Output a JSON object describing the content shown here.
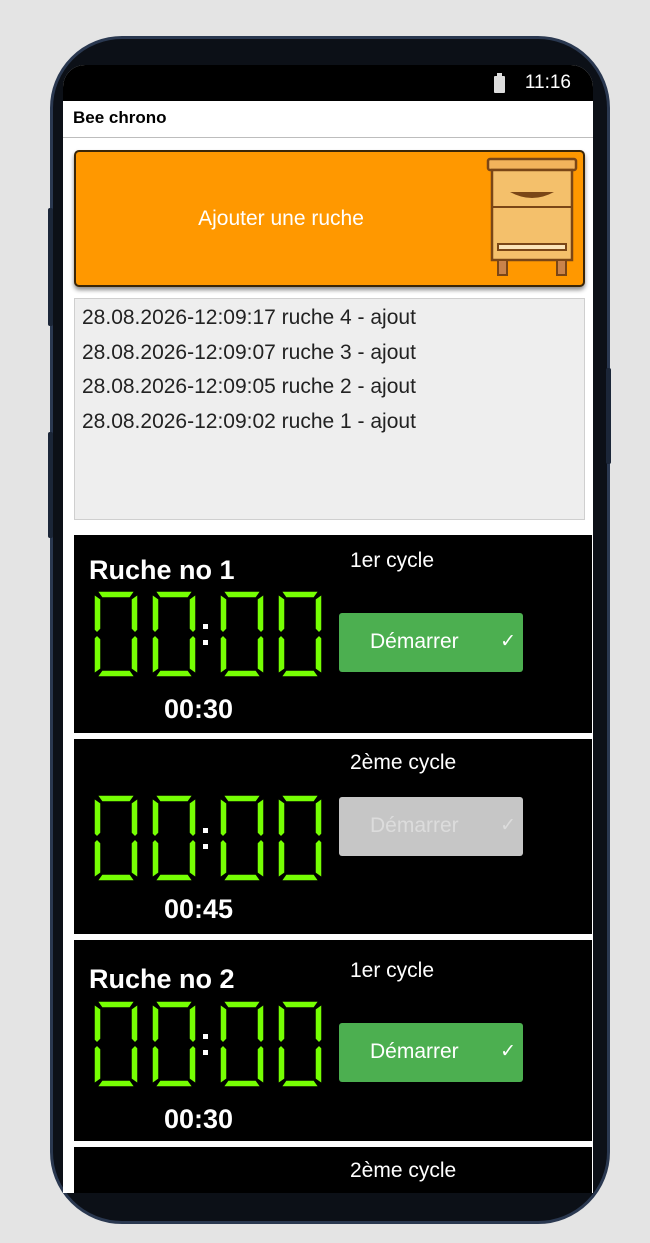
{
  "status_bar": {
    "time": "11:16",
    "battery_icon": "battery-charging-icon"
  },
  "app": {
    "title": "Bee chrono"
  },
  "add_hive": {
    "label": "Ajouter une ruche",
    "icon": "beehive-icon",
    "color": "#ff9800"
  },
  "log": {
    "lines": [
      "28.08.2026-12:09:17 ruche 4 - ajout",
      "28.08.2026-12:09:07 ruche 3 - ajout",
      "28.08.2026-12:09:05 ruche 2 - ajout",
      "28.08.2026-12:09:02 ruche 1 - ajout"
    ]
  },
  "hives": [
    {
      "title": "Ruche no 1",
      "cycles": [
        {
          "label": "1er cycle",
          "display": "00:00",
          "duration": "00:30",
          "button": "Démarrer",
          "enabled": true
        },
        {
          "label": "2ème cycle",
          "display": "00:00",
          "duration": "00:45",
          "button": "Démarrer",
          "enabled": false
        }
      ]
    },
    {
      "title": "Ruche no 2",
      "cycles": [
        {
          "label": "1er cycle",
          "display": "00:00",
          "duration": "00:30",
          "button": "Démarrer",
          "enabled": true
        },
        {
          "label": "2ème cycle"
        }
      ]
    }
  ],
  "colors": {
    "segment": "#76ff03",
    "button_enabled": "#4caf50",
    "button_disabled": "#c6c6c6",
    "panel": "#000000"
  }
}
